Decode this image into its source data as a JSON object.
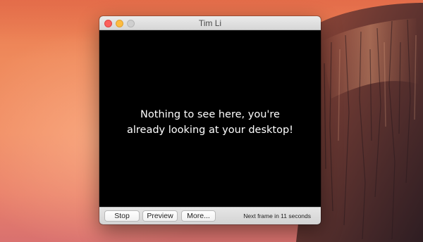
{
  "window": {
    "title": "Tim Li",
    "message_line_1": "Nothing to see here, you're",
    "message_line_2": "already looking at your desktop!"
  },
  "footer": {
    "stop_label": "Stop",
    "preview_label": "Preview",
    "more_label": "More...",
    "status_text": "Next frame in 11 seconds"
  },
  "icons": {
    "close": "close-button-icon",
    "minimize": "minimize-button-icon",
    "zoom": "zoom-button-icon"
  },
  "colors": {
    "close_red": "#fc605c",
    "minimize_yellow": "#fdbc40",
    "zoom_disabled_gray": "#cfcfcf",
    "content_background": "#000000",
    "message_text": "#ffffff"
  }
}
